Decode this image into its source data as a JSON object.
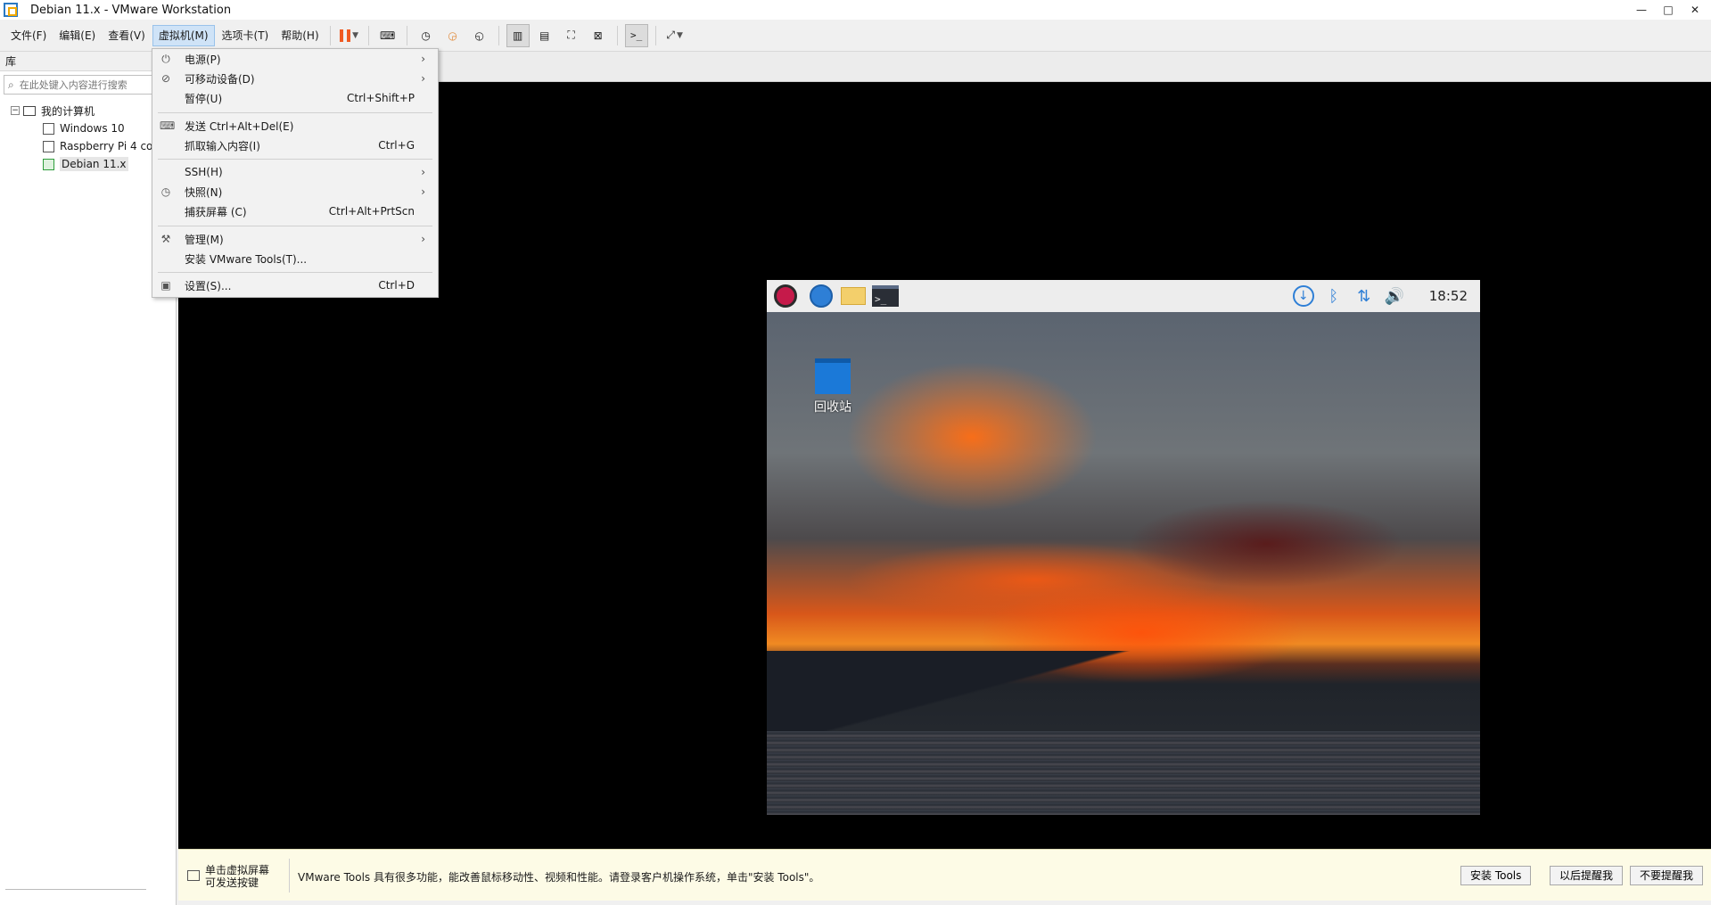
{
  "window": {
    "title": "Debian 11.x - VMware Workstation"
  },
  "menubar": {
    "items": [
      {
        "label": "文件(F)"
      },
      {
        "label": "编辑(E)"
      },
      {
        "label": "查看(V)"
      },
      {
        "label": "虚拟机(M)"
      },
      {
        "label": "选项卡(T)"
      },
      {
        "label": "帮助(H)"
      }
    ]
  },
  "library": {
    "header": "库",
    "search_placeholder": "在此处键入内容进行搜索",
    "root": "我的计算机",
    "vms": [
      {
        "label": "Windows 10"
      },
      {
        "label": "Raspberry Pi 4 co"
      },
      {
        "label": "Debian 11.x"
      }
    ]
  },
  "vm_menu": {
    "items": [
      {
        "label": "电源(P)",
        "shortcut": ""
      },
      {
        "label": "可移动设备(D)",
        "shortcut": ""
      },
      {
        "label": "暂停(U)",
        "shortcut": "Ctrl+Shift+P"
      },
      {
        "label": "发送 Ctrl+Alt+Del(E)",
        "shortcut": ""
      },
      {
        "label": "抓取输入内容(I)",
        "shortcut": "Ctrl+G"
      },
      {
        "label": "SSH(H)",
        "shortcut": ""
      },
      {
        "label": "快照(N)",
        "shortcut": ""
      },
      {
        "label": "捕获屏幕 (C)",
        "shortcut": "Ctrl+Alt+PrtScn"
      },
      {
        "label": "管理(M)",
        "shortcut": ""
      },
      {
        "label": "安装 VMware Tools(T)...",
        "shortcut": ""
      },
      {
        "label": "设置(S)...",
        "shortcut": "Ctrl+D"
      }
    ]
  },
  "guest": {
    "clock": "18:52",
    "trash_label": "回收站",
    "terminal_glyph": ">_"
  },
  "hintbar": {
    "left_line1": "单击虚拟屏幕",
    "left_line2": "可发送按键",
    "message": "VMware Tools 具有很多功能，能改善鼠标移动性、视频和性能。请登录客户机操作系统，单击\"安装 Tools\"。",
    "install_button": "安装 Tools",
    "remind_button": "以后提醒我",
    "never_button": "不要提醒我"
  },
  "colors": {
    "accent": "#2b79c2",
    "pause": "#f05a22",
    "hint_bg": "#fdfbe6",
    "menu_active": "#cfe3f7"
  }
}
